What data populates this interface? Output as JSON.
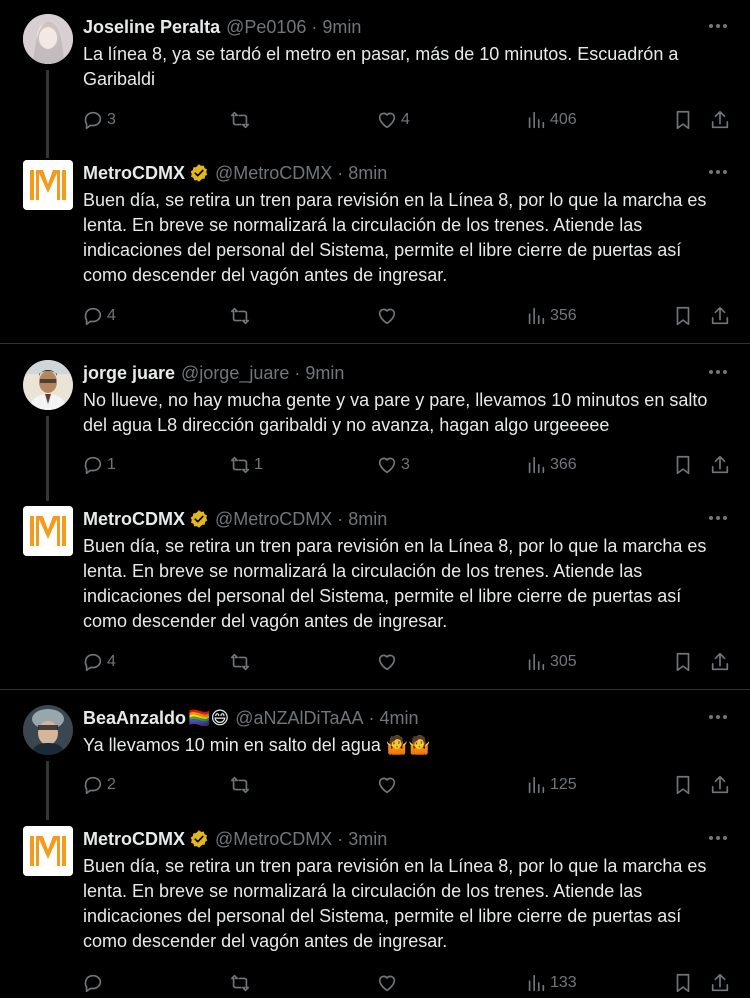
{
  "tweets": [
    {
      "name": "Joseline Peralta",
      "handle": "@Pe0106",
      "time": "9min",
      "text": "La línea 8, ya se tardó el metro en pasar, más de 10 minutos. Escuadrón a Garibaldi",
      "replies": "3",
      "retweets": "",
      "likes": "4",
      "views": "406"
    },
    {
      "name": "MetroCDMX",
      "handle": "@MetroCDMX",
      "time": "8min",
      "text": "Buen día, se retira un tren para revisión en la Línea 8, por lo que la marcha es lenta. En breve se normalizará la circulación de los trenes. Atiende las indicaciones del personal del Sistema, permite el libre cierre de puertas así como descender del vagón antes de ingresar.",
      "replies": "4",
      "retweets": "",
      "likes": "",
      "views": "356"
    },
    {
      "name": "jorge juare",
      "handle": "@jorge_juare",
      "time": "9min",
      "text": "No llueve, no hay mucha gente y va pare y pare, llevamos 10 minutos en salto del agua L8 dirección garibaldi y no avanza, hagan algo urgeeeee",
      "replies": "1",
      "retweets": "1",
      "likes": "3",
      "views": "366"
    },
    {
      "name": "MetroCDMX",
      "handle": "@MetroCDMX",
      "time": "8min",
      "text": "Buen día, se retira un tren para revisión en la Línea 8, por lo que la marcha es lenta. En breve se normalizará la circulación de los trenes. Atiende las indicaciones del personal del Sistema, permite el libre cierre de puertas así como descender del vagón antes de ingresar.",
      "replies": "4",
      "retweets": "",
      "likes": "",
      "views": "305"
    },
    {
      "name": "BeaAnzaldo",
      "name_emoji": "🏳️‍🌈😄",
      "handle": "@aNZAlDiTaAA",
      "time": "4min",
      "text": "Ya llevamos 10 min en salto del agua",
      "text_emoji": "🤷🤷",
      "replies": "2",
      "retweets": "",
      "likes": "",
      "views": "125"
    },
    {
      "name": "MetroCDMX",
      "handle": "@MetroCDMX",
      "time": "3min",
      "text": "Buen día, se retira un tren para revisión en la Línea 8, por lo que la marcha es lenta. En breve se normalizará la circulación de los trenes. Atiende las indicaciones del personal del Sistema, permite el libre cierre de puertas así como descender del vagón antes de ingresar.",
      "replies": "",
      "retweets": "",
      "likes": "",
      "views": "133"
    }
  ],
  "separator": "·",
  "colors": {
    "background": "#000000",
    "text": "#e7e9ea",
    "muted": "#71767b",
    "verified": "#e2b719",
    "metro_orange": "#f59a1b"
  }
}
